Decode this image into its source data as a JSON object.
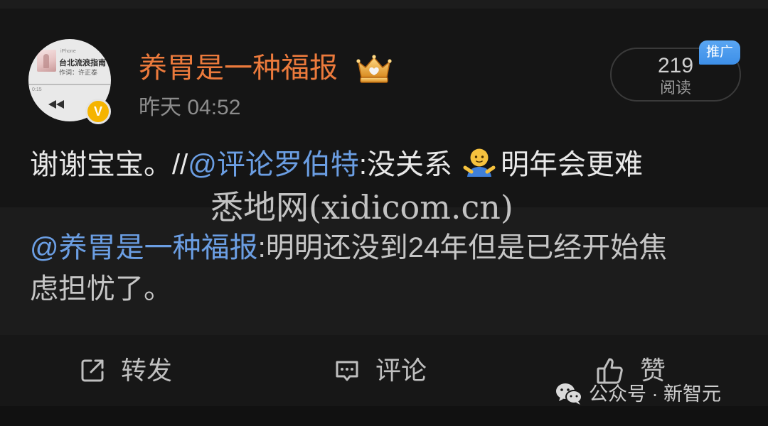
{
  "post": {
    "avatar": {
      "device_label": "iPhone",
      "song_title": "台北流浪指南",
      "lyricist": "作词：许正泰",
      "elapsed": "0:15",
      "control_icon": "rewind-icon"
    },
    "author": {
      "name": "养胃是一种福报",
      "badge_icon": "crown-icon",
      "verified_icon": "verified-v-icon",
      "verified_text": "V"
    },
    "timestamp": "昨天 04:52",
    "stats": {
      "reads_count": "219",
      "reads_label": "阅读",
      "promo_tag": "推广"
    },
    "body": {
      "lead": "谢谢宝宝。//",
      "mention": "@评论罗伯特",
      "text_before_emoji": ":没关系",
      "emoji_icon": "open-arms-person-emoji",
      "text_after_emoji": "明年会更难"
    },
    "repost": {
      "mention": "@养胃是一种福报",
      "line1_text": ":明明还没到24年但是已经开始焦",
      "line2_text": "虑担忧了。"
    }
  },
  "actions": [
    {
      "icon": "share-icon",
      "label": "转发"
    },
    {
      "icon": "comment-icon",
      "label": "评论"
    },
    {
      "icon": "thumbs-up-icon",
      "label": "赞"
    }
  ],
  "watermarks": {
    "site": "悉地网(xidicom.cn)",
    "wechat_icon": "wechat-icon",
    "wechat_text": "公众号 · 新智元"
  },
  "colors": {
    "background": "#151515",
    "repost_background": "#1c1c1c",
    "username": "#ec7a3c",
    "mention": "#6b9ee3",
    "body_text": "#e8e8e8",
    "muted_text": "#8c8c8c",
    "action_text": "#bfbfbf",
    "promo_tag": "#3d8fe8",
    "verified_badge": "#f5b400"
  }
}
